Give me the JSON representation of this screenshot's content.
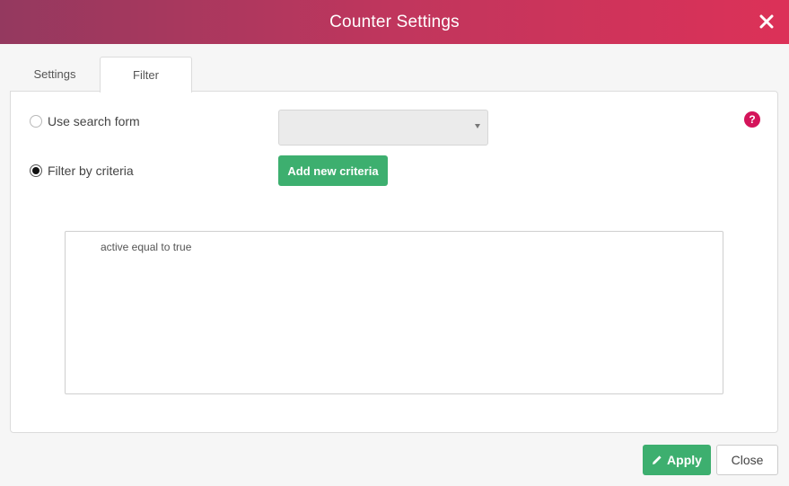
{
  "dialog": {
    "title": "Counter Settings",
    "close_icon": "close-icon"
  },
  "tabs": [
    {
      "label": "Settings",
      "active": false
    },
    {
      "label": "Filter",
      "active": true
    }
  ],
  "filter": {
    "use_search_form_label": "Use search form",
    "use_search_form_selected": false,
    "search_form_select_value": "",
    "filter_by_criteria_label": "Filter by criteria",
    "filter_by_criteria_selected": true,
    "add_criteria_label": "Add new criteria",
    "help_label": "?",
    "criteria": [
      "active equal to true"
    ]
  },
  "footer": {
    "apply_label": "Apply",
    "apply_icon": "pencil-icon",
    "close_label": "Close"
  },
  "colors": {
    "header_gradient_start": "#94395f",
    "header_gradient_end": "#dc3158",
    "accent_green": "#3daf6f",
    "help_pink": "#d4145a"
  }
}
